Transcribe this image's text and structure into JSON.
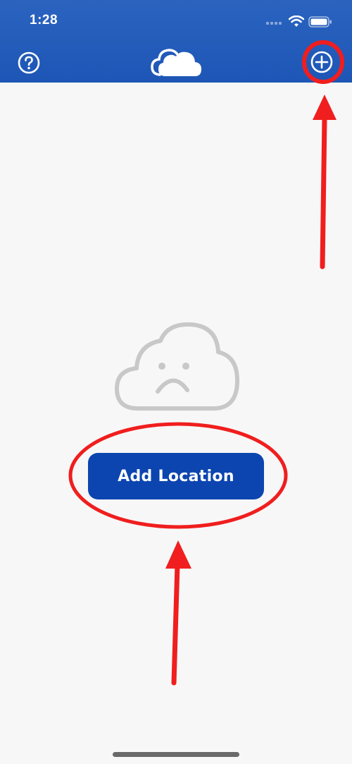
{
  "status_bar": {
    "time": "1:28"
  },
  "header": {
    "help_icon": "question-circle-icon",
    "logo_icon": "cloud-logo-icon",
    "add_icon": "plus-circle-icon"
  },
  "empty_state": {
    "icon": "sad-cloud-icon"
  },
  "main": {
    "add_location_label": "Add Location"
  },
  "colors": {
    "header_blue": "#2b63bf",
    "button_blue": "#0c45b0",
    "annotation_red": "#f01e1e",
    "background": "#f7f7f7"
  }
}
